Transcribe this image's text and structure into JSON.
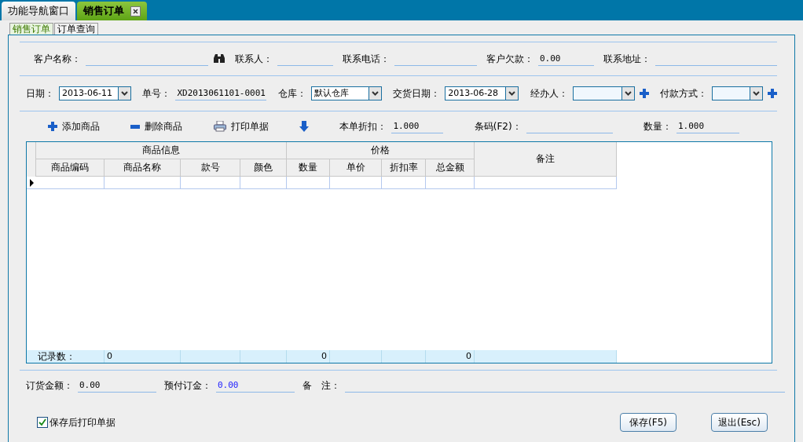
{
  "tabs": [
    {
      "label": "功能导航窗口",
      "selected": false,
      "closable": false
    },
    {
      "label": "销售订单",
      "selected": true,
      "closable": true
    }
  ],
  "sub_tabs": [
    {
      "label": "销售订单",
      "selected": true
    },
    {
      "label": "订单查询",
      "selected": false
    }
  ],
  "customer_row": [
    {
      "label": "客户名称：",
      "kind": "text",
      "search": true
    },
    {
      "label": "联系人：",
      "kind": "text"
    },
    {
      "label": "联系电话：",
      "kind": "text"
    },
    {
      "label": "客户欠款：",
      "kind": "text",
      "value": "0.00"
    },
    {
      "label": "联系地址：",
      "kind": "text"
    }
  ],
  "order_row": [
    {
      "label": "日期：",
      "kind": "combo",
      "value": "2013-06-11"
    },
    {
      "label": "单号：",
      "kind": "text",
      "value": "XD2013061101-0001"
    },
    {
      "label": "仓库：",
      "kind": "combo",
      "value": "默认仓库"
    },
    {
      "label": "交货日期：",
      "kind": "combo",
      "value": "2013-06-28"
    },
    {
      "label": "经办人：",
      "kind": "combo",
      "add": true
    },
    {
      "label": "付款方式：",
      "kind": "combo",
      "add": true
    }
  ],
  "toolbar": [
    {
      "kind": "add",
      "label": "添加商品"
    },
    {
      "kind": "remove",
      "label": "删除商品"
    },
    {
      "kind": "print",
      "label": "打印单据"
    },
    {
      "kind": "move_down"
    },
    {
      "kind": "field",
      "label": "本单折扣：",
      "value": "1.000"
    },
    {
      "kind": "field",
      "label": "条码(F2)："
    },
    {
      "kind": "field",
      "label": "数量：",
      "value": "1.000"
    }
  ],
  "grid": {
    "groups": [
      {
        "label": "商品信息",
        "columns": [
          {
            "label": "商品编码"
          },
          {
            "label": "商品名称",
            "footer": "0"
          },
          {
            "label": "款号"
          },
          {
            "label": "颜色"
          }
        ]
      },
      {
        "label": "价格",
        "columns": [
          {
            "label": "数量",
            "footer": "0"
          },
          {
            "label": "单价"
          },
          {
            "label": "折扣率"
          },
          {
            "label": "总金额",
            "footer": "0"
          }
        ]
      }
    ],
    "remarks_header": "备注",
    "rows": [
      {
        "current": true
      }
    ],
    "footer_label": "记录数："
  },
  "totals": [
    {
      "label": "订货金额：",
      "value": "0.00",
      "emphasis": false
    },
    {
      "label": "预付订金：",
      "value": "0.00",
      "emphasis": true
    },
    {
      "label": "备　注："
    }
  ],
  "print_after_save": {
    "label": "保存后打印单据",
    "checked": true
  },
  "buttons": [
    "保存(F5)",
    "退出(Esc)"
  ]
}
